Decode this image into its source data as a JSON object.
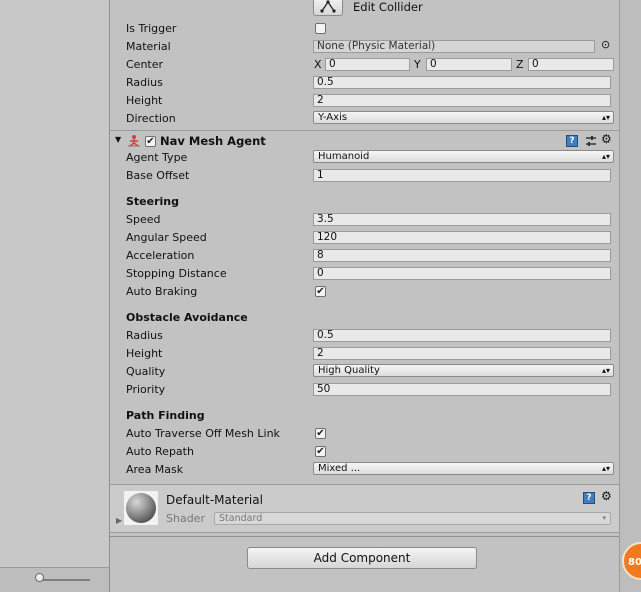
{
  "capsule": {
    "edit_collider": "Edit Collider",
    "is_trigger_label": "Is Trigger",
    "material_label": "Material",
    "material_value": "None (Physic Material)",
    "center_label": "Center",
    "center": {
      "x_label": "X",
      "x": "0",
      "y_label": "Y",
      "y": "0",
      "z_label": "Z",
      "z": "0"
    },
    "radius_label": "Radius",
    "radius": "0.5",
    "height_label": "Height",
    "height": "2",
    "direction_label": "Direction",
    "direction": "Y-Axis"
  },
  "nav_mesh_agent": {
    "title": "Nav Mesh Agent",
    "enabled": true,
    "agent_type_label": "Agent Type",
    "agent_type": "Humanoid",
    "base_offset_label": "Base Offset",
    "base_offset": "1",
    "steering_header": "Steering",
    "speed_label": "Speed",
    "speed": "3.5",
    "angular_speed_label": "Angular Speed",
    "angular_speed": "120",
    "acceleration_label": "Acceleration",
    "acceleration": "8",
    "stopping_distance_label": "Stopping Distance",
    "stopping_distance": "0",
    "auto_braking_label": "Auto Braking",
    "auto_braking": true,
    "obstacle_header": "Obstacle Avoidance",
    "oa_radius_label": "Radius",
    "oa_radius": "0.5",
    "oa_height_label": "Height",
    "oa_height": "2",
    "quality_label": "Quality",
    "quality": "High Quality",
    "priority_label": "Priority",
    "priority": "50",
    "path_header": "Path Finding",
    "auto_traverse_label": "Auto Traverse Off Mesh Link",
    "auto_traverse": true,
    "auto_repath_label": "Auto Repath",
    "auto_repath": true,
    "area_mask_label": "Area Mask",
    "area_mask": "Mixed ..."
  },
  "material": {
    "name": "Default-Material",
    "shader_label": "Shader",
    "shader": "Standard"
  },
  "add_component": "Add Component",
  "badge": "80",
  "icons": {
    "check": "✔",
    "dropdown": "▲▼",
    "foldout_open": "▼",
    "foldout_closed": "▶",
    "object_picker": "⊙"
  },
  "colors": {
    "background": "#c2c2c2",
    "field": "#e9e9e9",
    "badge": "#f07a1e",
    "help_icon": "#3d7fbf"
  }
}
